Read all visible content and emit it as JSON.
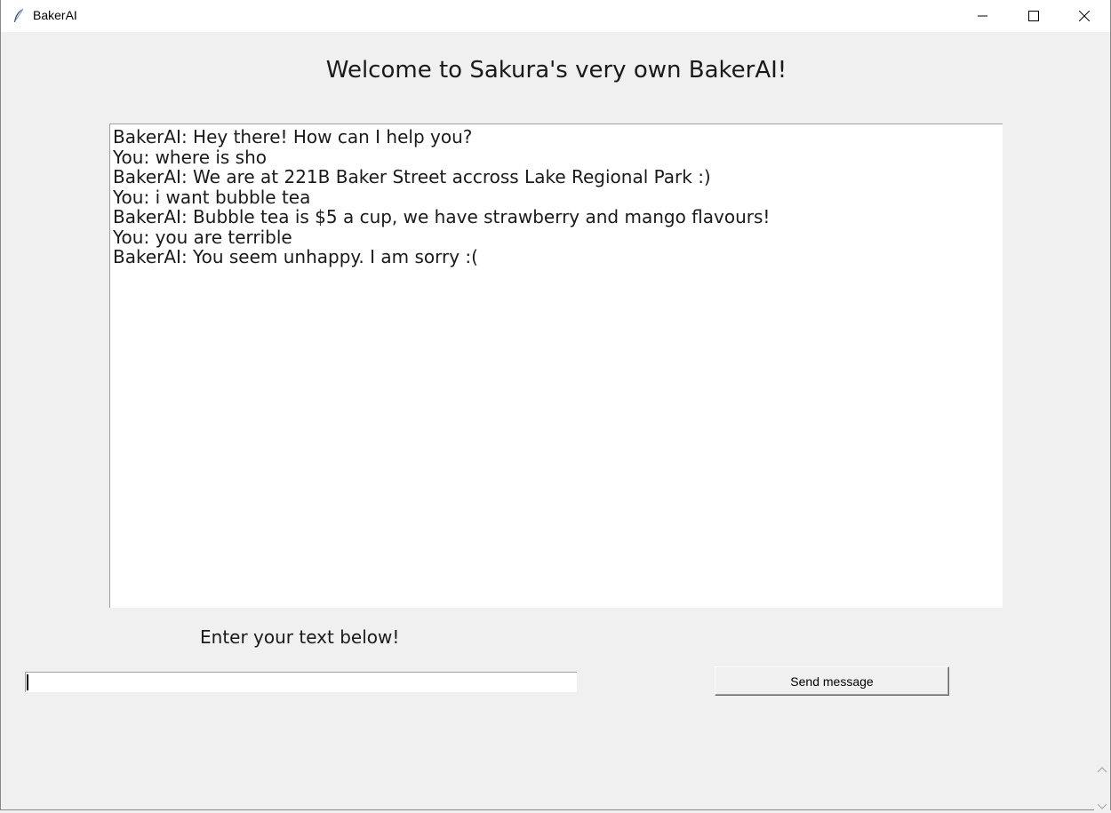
{
  "window": {
    "title": "BakerAI",
    "icons": {
      "app": "feather-icon",
      "minimize": "minimize-icon",
      "maximize": "maximize-icon",
      "close": "close-icon"
    }
  },
  "header": {
    "title": "Welcome to Sakura's very own BakerAI!"
  },
  "chat": {
    "messages": [
      "BakerAI: Hey there! How can I help you?",
      "You: where is sho",
      "BakerAI: We are at 221B Baker Street accross Lake Regional Park :)",
      "You: i want bubble tea",
      "BakerAI: Bubble tea is $5 a cup, we have strawberry and mango flavours!",
      "You: you are terrible",
      "BakerAI: You seem unhappy. I am sorry :("
    ]
  },
  "input": {
    "label": "Enter your text below!",
    "value": ""
  },
  "send": {
    "label": "Send message"
  },
  "colors": {
    "background": "#f0f0f0",
    "text_area": "#ffffff",
    "text": "#1a1a1a"
  }
}
